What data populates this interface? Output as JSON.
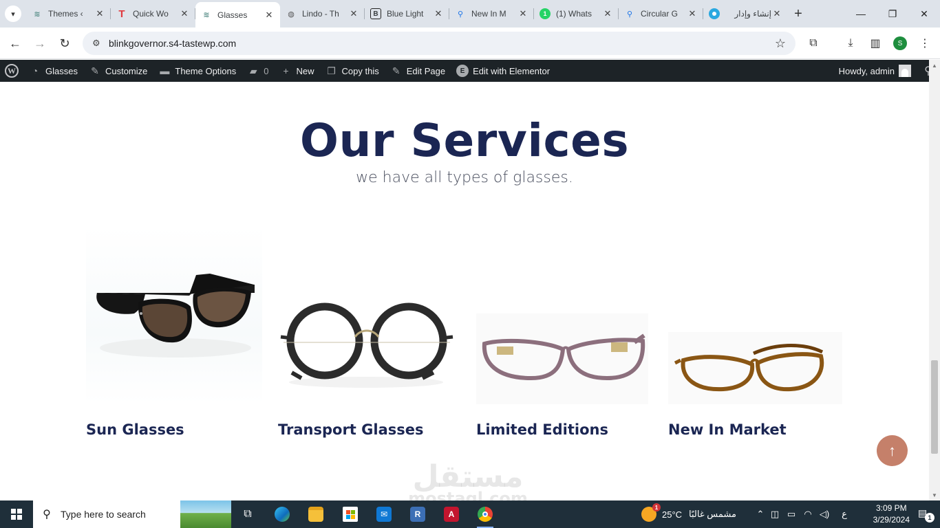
{
  "browser": {
    "tabs": [
      {
        "title": "Themes ‹",
        "favicon": "wp-glasses-favicon",
        "active": false
      },
      {
        "title": "Quick Wo",
        "favicon": "t-favicon",
        "active": false
      },
      {
        "title": "Glasses",
        "favicon": "wp-glasses-favicon",
        "active": true
      },
      {
        "title": "Lindo - Th",
        "favicon": "globe-favicon",
        "active": false
      },
      {
        "title": "Blue Light",
        "favicon": "b-favicon",
        "active": false
      },
      {
        "title": "New In M",
        "favicon": "search-favicon",
        "active": false
      },
      {
        "title": "(1) Whats",
        "favicon": "whatsapp-favicon",
        "active": false
      },
      {
        "title": "Circular G",
        "favicon": "search-favicon",
        "active": false
      },
      {
        "title": "إنشاء وإدار",
        "favicon": "circle-favicon",
        "active": false
      }
    ],
    "url": "blinkgovernor.s4-tastewp.com",
    "profile_initial": "S"
  },
  "adminbar": {
    "site_name": "Glasses",
    "customize": "Customize",
    "theme_options": "Theme Options",
    "comments_count": "0",
    "new": "New",
    "copy_this": "Copy this",
    "edit_page": "Edit Page",
    "edit_elementor": "Edit with Elementor",
    "howdy": "Howdy, admin"
  },
  "services": {
    "title": "Our Services",
    "subtitle": "we have all types of glasses.",
    "items": [
      {
        "name": "Sun Glasses"
      },
      {
        "name": "Transport Glasses"
      },
      {
        "name": "Limited Editions"
      },
      {
        "name": "New In Market"
      }
    ]
  },
  "watermark": {
    "arabic": "مستقل",
    "latin": "mostaql.com"
  },
  "taskbar": {
    "search_placeholder": "Type here to search",
    "weather_temp": "25°C",
    "weather_desc": "مشمس غالبًا",
    "weather_badge": "1",
    "language": "ع",
    "time": "3:09 PM",
    "date": "3/29/2024",
    "notification_count": "1"
  },
  "colors": {
    "heading": "#1b2653",
    "adminbar": "#1d2327",
    "scroll_top_button": "#c5806a",
    "taskbar": "#1f2f3a"
  }
}
